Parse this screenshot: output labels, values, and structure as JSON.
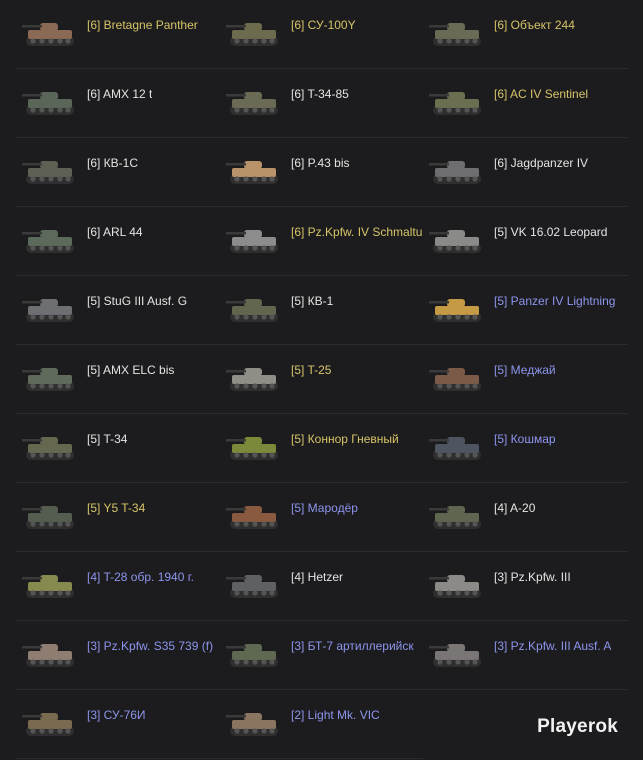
{
  "tanks": [
    {
      "label": "[6] Bretagne Panther",
      "kind": "premium",
      "color": "#8a6a55"
    },
    {
      "label": "[6] СУ-100Y",
      "kind": "premium",
      "color": "#6d6b4d"
    },
    {
      "label": "[6] Объект 244",
      "kind": "premium",
      "color": "#6a6a55"
    },
    {
      "label": "[6] AMX 12 t",
      "kind": "regular",
      "color": "#5a6658"
    },
    {
      "label": "[6] T-34-85",
      "kind": "regular",
      "color": "#6a6a55"
    },
    {
      "label": "[6] AC IV Sentinel",
      "kind": "premium",
      "color": "#6b6e50"
    },
    {
      "label": "[6] КВ-1С",
      "kind": "regular",
      "color": "#5d6052"
    },
    {
      "label": "[6] P.43 bis",
      "kind": "regular",
      "color": "#b8936a"
    },
    {
      "label": "[6] Jagdpanzer IV",
      "kind": "regular",
      "color": "#6e6e72"
    },
    {
      "label": "[6] ARL 44",
      "kind": "regular",
      "color": "#5b6a5a"
    },
    {
      "label": "[6] Pz.Kpfw. IV Schmaltu",
      "kind": "premium",
      "color": "#8c8c8c"
    },
    {
      "label": "[5] VK 16.02 Leopard",
      "kind": "regular",
      "color": "#8a8a88"
    },
    {
      "label": "[5] StuG III Ausf. G",
      "kind": "regular",
      "color": "#6d6f72"
    },
    {
      "label": "[5] КВ-1",
      "kind": "regular",
      "color": "#62664f"
    },
    {
      "label": "[5] Panzer IV Lightning",
      "kind": "special",
      "color": "#c59a45"
    },
    {
      "label": "[5] AMX ELC bis",
      "kind": "regular",
      "color": "#5f6a5a"
    },
    {
      "label": "[5] T-25",
      "kind": "premium",
      "color": "#8e8e86"
    },
    {
      "label": "[5] Меджай",
      "kind": "special",
      "color": "#7b5b48"
    },
    {
      "label": "[5] T-34",
      "kind": "regular",
      "color": "#66674f"
    },
    {
      "label": "[5] Коннор Гневный",
      "kind": "premium",
      "color": "#7a8a3a"
    },
    {
      "label": "[5] Кошмар",
      "kind": "special",
      "color": "#4e5560"
    },
    {
      "label": "[5] Y5 T-34",
      "kind": "premium",
      "color": "#555c50"
    },
    {
      "label": "[5] Мародёр",
      "kind": "special",
      "color": "#8a5a40"
    },
    {
      "label": "[4] A-20",
      "kind": "regular",
      "color": "#5e6650"
    },
    {
      "label": "[4] T-28 обр. 1940 г.",
      "kind": "special",
      "color": "#868a4f"
    },
    {
      "label": "[4] Hetzer",
      "kind": "regular",
      "color": "#5e6064"
    },
    {
      "label": "[3] Pz.Kpfw. III",
      "kind": "regular",
      "color": "#8b8a87"
    },
    {
      "label": "[3] Pz.Kpfw. S35 739 (f)",
      "kind": "special",
      "color": "#8e7d70"
    },
    {
      "label": "[3] БТ-7 артиллерийск",
      "kind": "special",
      "color": "#5f6850"
    },
    {
      "label": "[3] Pz.Kpfw. III Ausf. A",
      "kind": "special",
      "color": "#7a7676"
    },
    {
      "label": "[3] СУ-76И",
      "kind": "special",
      "color": "#7a6a50"
    },
    {
      "label": "[2] Light Mk. VIC",
      "kind": "special",
      "color": "#8a7560"
    }
  ],
  "watermark": "Playerok"
}
